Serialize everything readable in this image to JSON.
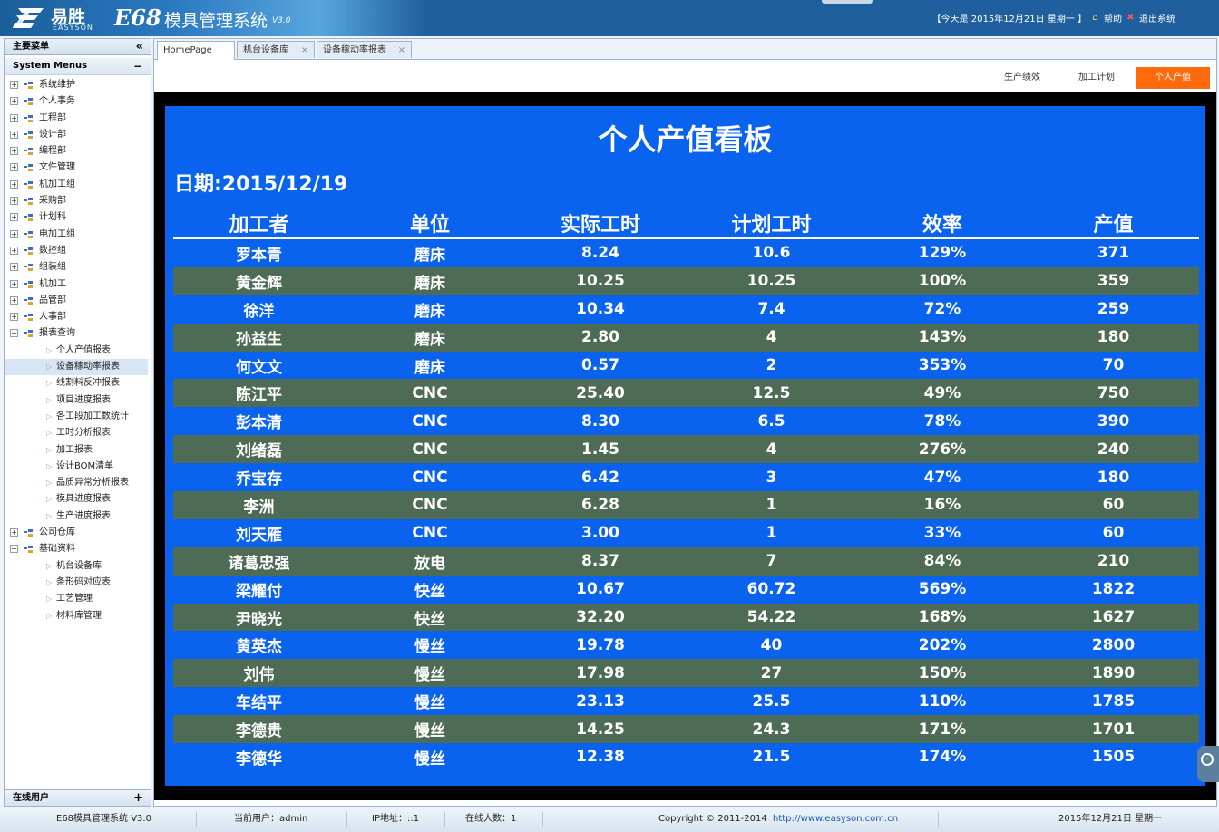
{
  "header": {
    "logo_cn": "易胜",
    "logo_en": "EASYSON",
    "system_code": "E68",
    "system_name": "模具管理系统",
    "version": "V3.0",
    "today": "【今天是 2015年12月21日 星期一 】",
    "help": "帮助",
    "logout": "退出系统"
  },
  "sidebar": {
    "title": "主要菜单",
    "menus_label": "System Menus",
    "online_label": "在线用户",
    "items": [
      {
        "label": "系统维护",
        "level": 0
      },
      {
        "label": "个人事务",
        "level": 0
      },
      {
        "label": "工程部",
        "level": 0
      },
      {
        "label": "设计部",
        "level": 0
      },
      {
        "label": "编程部",
        "level": 0
      },
      {
        "label": "文件管理",
        "level": 0
      },
      {
        "label": "机加工组",
        "level": 0
      },
      {
        "label": "采购部",
        "level": 0
      },
      {
        "label": "计划科",
        "level": 0
      },
      {
        "label": "电加工组",
        "level": 0
      },
      {
        "label": "数控组",
        "level": 0
      },
      {
        "label": "组装组",
        "level": 0
      },
      {
        "label": "机加工",
        "level": 0
      },
      {
        "label": "品管部",
        "level": 0
      },
      {
        "label": "人事部",
        "level": 0
      },
      {
        "label": "报表查询",
        "level": 0,
        "expanded": true
      },
      {
        "label": "个人产值报表",
        "level": 1
      },
      {
        "label": "设备稼动率报表",
        "level": 1,
        "selected": true
      },
      {
        "label": "线割料反冲报表",
        "level": 1
      },
      {
        "label": "项目进度报表",
        "level": 1
      },
      {
        "label": "各工段加工数统计",
        "level": 1
      },
      {
        "label": "工时分析报表",
        "level": 1
      },
      {
        "label": "加工报表",
        "level": 1
      },
      {
        "label": "设计BOM清单",
        "level": 1
      },
      {
        "label": "品质异常分析报表",
        "level": 1
      },
      {
        "label": "模具进度报表",
        "level": 1
      },
      {
        "label": "生产进度报表",
        "level": 1
      },
      {
        "label": "公司仓库",
        "level": 0
      },
      {
        "label": "基础资料",
        "level": 0,
        "expanded": true
      },
      {
        "label": "机台设备库",
        "level": 1
      },
      {
        "label": "条形码对应表",
        "level": 1
      },
      {
        "label": "工艺管理",
        "level": 1
      },
      {
        "label": "材料库管理",
        "level": 1
      }
    ]
  },
  "tabs": [
    {
      "label": "HomePage",
      "closable": false,
      "active": true
    },
    {
      "label": "机台设备库",
      "closable": true
    },
    {
      "label": "设备稼动率报表",
      "closable": true
    }
  ],
  "subtabs": [
    {
      "label": "生产绩效"
    },
    {
      "label": "加工计划"
    },
    {
      "label": "个人产值",
      "active": true
    }
  ],
  "board": {
    "title": "个人产值看板",
    "date": "日期:2015/12/19",
    "columns": [
      "加工者",
      "单位",
      "实际工时",
      "计划工时",
      "效率",
      "产值"
    ],
    "rows": [
      [
        "罗本青",
        "磨床",
        "8.24",
        "10.6",
        "129%",
        "371"
      ],
      [
        "黄金辉",
        "磨床",
        "10.25",
        "10.25",
        "100%",
        "359"
      ],
      [
        "徐洋",
        "磨床",
        "10.34",
        "7.4",
        "72%",
        "259"
      ],
      [
        "孙益生",
        "磨床",
        "2.80",
        "4",
        "143%",
        "180"
      ],
      [
        "何文文",
        "磨床",
        "0.57",
        "2",
        "353%",
        "70"
      ],
      [
        "陈江平",
        "CNC",
        "25.40",
        "12.5",
        "49%",
        "750"
      ],
      [
        "彭本清",
        "CNC",
        "8.30",
        "6.5",
        "78%",
        "390"
      ],
      [
        "刘绪磊",
        "CNC",
        "1.45",
        "4",
        "276%",
        "240"
      ],
      [
        "乔宝存",
        "CNC",
        "6.42",
        "3",
        "47%",
        "180"
      ],
      [
        "李洲",
        "CNC",
        "6.28",
        "1",
        "16%",
        "60"
      ],
      [
        "刘天雁",
        "CNC",
        "3.00",
        "1",
        "33%",
        "60"
      ],
      [
        "诸葛忠强",
        "放电",
        "8.37",
        "7",
        "84%",
        "210"
      ],
      [
        "梁耀付",
        "快丝",
        "10.67",
        "60.72",
        "569%",
        "1822"
      ],
      [
        "尹晓光",
        "快丝",
        "32.20",
        "54.22",
        "168%",
        "1627"
      ],
      [
        "黄英杰",
        "慢丝",
        "19.78",
        "40",
        "202%",
        "2800"
      ],
      [
        "刘伟",
        "慢丝",
        "17.98",
        "27",
        "150%",
        "1890"
      ],
      [
        "车结平",
        "慢丝",
        "23.13",
        "25.5",
        "110%",
        "1785"
      ],
      [
        "李德贵",
        "慢丝",
        "14.25",
        "24.3",
        "171%",
        "1701"
      ],
      [
        "李德华",
        "慢丝",
        "12.38",
        "21.5",
        "174%",
        "1505"
      ]
    ],
    "row_colors": {
      "normal": "#0a63ef",
      "alt": "#4e6b55"
    }
  },
  "footer": {
    "app": "E68模具管理系统 V3.0",
    "user": "当前用户：admin",
    "ip": "IP地址：::1",
    "online": "在线人数：1",
    "copyright": "Copyright © 2011-2014",
    "url": "http://www.easyson.com.cn",
    "date": "2015年12月21日 星期一"
  },
  "colors": {
    "header_blue": "#1f5f9e",
    "accent_orange": "#ff6a0c",
    "board_blue": "#0a63ef"
  }
}
